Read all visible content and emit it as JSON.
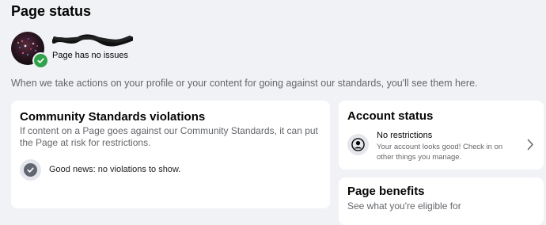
{
  "header": {
    "title": "Page status"
  },
  "profile": {
    "status_text": "Page has no issues"
  },
  "notice": {
    "text": "When we take actions on your profile or your content for going against our standards, you'll see them here."
  },
  "violations": {
    "title": "Community Standards violations",
    "description": "If content on a Page goes against our Community Standards, it can put the Page at risk for restrictions.",
    "status_text": "Good news: no violations to show."
  },
  "account_status": {
    "title": "Account status",
    "label": "No restrictions",
    "detail": "Your account looks good! Check in on other things you manage."
  },
  "benefits": {
    "title": "Page benefits",
    "description": "See what you're eligible for"
  },
  "colors": {
    "background": "#f0f2f5",
    "card": "#ffffff",
    "success": "#31a24c",
    "secondary_text": "#65676b"
  },
  "icons": [
    "avatar",
    "check-badge-icon",
    "check-circle-icon",
    "user-circle-icon",
    "chevron-right-icon"
  ]
}
